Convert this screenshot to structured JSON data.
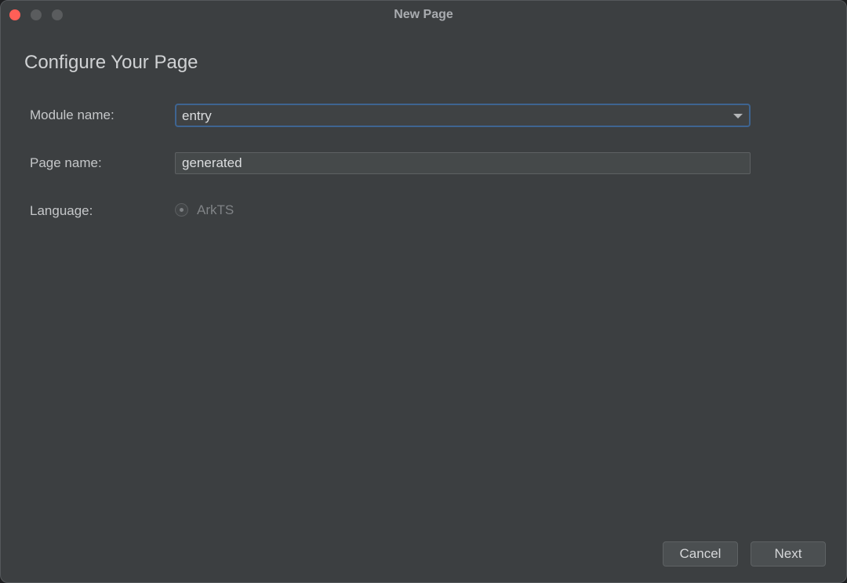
{
  "window": {
    "title": "New Page"
  },
  "page": {
    "heading": "Configure Your Page"
  },
  "form": {
    "module": {
      "label": "Module name:",
      "value": "entry"
    },
    "page_name": {
      "label": "Page name:",
      "value": "generated"
    },
    "language": {
      "label": "Language:",
      "option": "ArkTS",
      "selected": true
    }
  },
  "buttons": {
    "cancel_label": "Cancel",
    "next_label": "Next"
  },
  "icons": {
    "close": "close-traffic-light-icon",
    "minimize": "minimize-traffic-light-icon",
    "maximize": "maximize-traffic-light-icon",
    "dropdown": "chevron-down-icon",
    "radio": "radio-selected-icon"
  },
  "colors": {
    "background": "#3c3f41",
    "close_button": "#ff5f57",
    "focus_border": "#3e6491",
    "text": "#c5c7c9"
  }
}
